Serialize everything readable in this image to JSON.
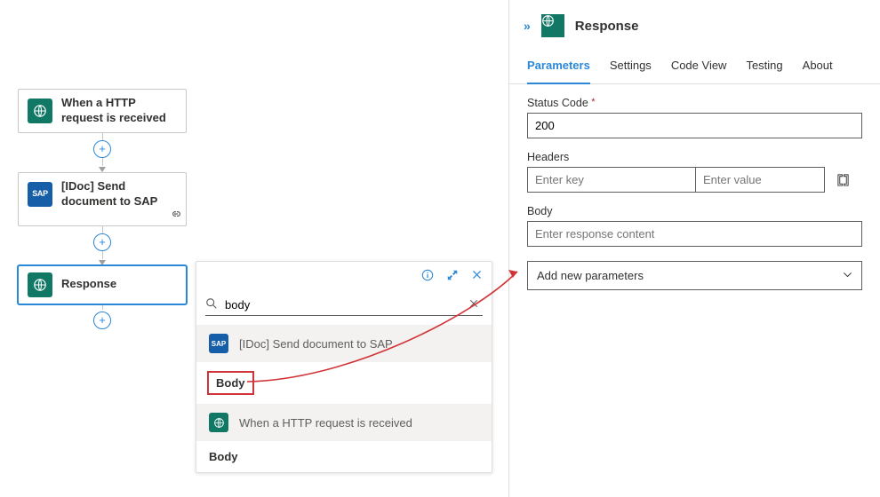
{
  "workflow": {
    "step1": {
      "label": "When a HTTP request is received"
    },
    "step2": {
      "label": "[IDoc] Send document to SAP"
    },
    "step3": {
      "label": "Response"
    }
  },
  "picker": {
    "search_value": "body",
    "group_sap": "[IDoc] Send document to SAP",
    "token_sap": "Body",
    "group_http": "When a HTTP request is received",
    "token_http": "Body",
    "sap_badge": "SAP"
  },
  "panel": {
    "title": "Response",
    "tabs": {
      "parameters": "Parameters",
      "settings": "Settings",
      "codeview": "Code View",
      "testing": "Testing",
      "about": "About"
    },
    "status_label": "Status Code",
    "status_value": "200",
    "headers_label": "Headers",
    "headers_key_ph": "Enter key",
    "headers_val_ph": "Enter value",
    "body_label": "Body",
    "body_ph": "Enter response content",
    "add_params": "Add new parameters"
  }
}
